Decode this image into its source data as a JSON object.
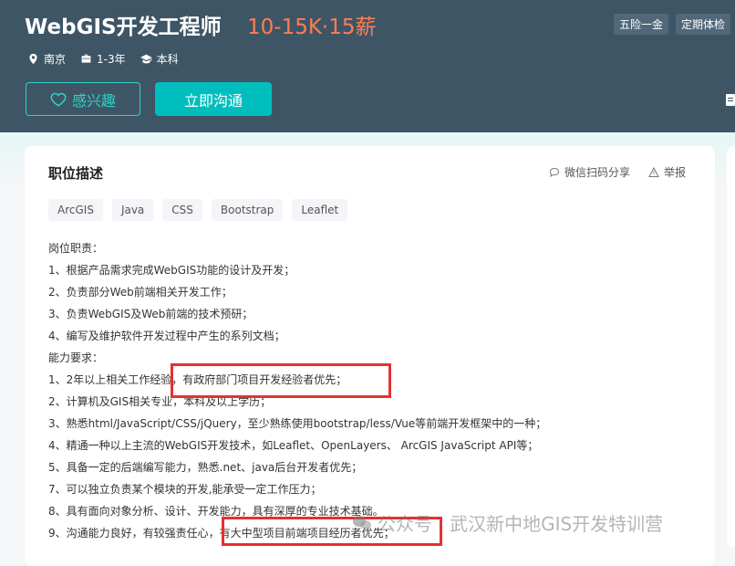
{
  "job": {
    "title": "WebGIS开发工程师",
    "salary": "10-15K·15薪",
    "benefits": [
      "五险一金",
      "定期体检"
    ],
    "meta": [
      {
        "icon": "location-icon",
        "text": "南京"
      },
      {
        "icon": "briefcase-icon",
        "text": "1-3年"
      },
      {
        "icon": "graduation-cap-icon",
        "text": "本科"
      }
    ]
  },
  "actions": {
    "interest_label": "感兴趣",
    "chat_label": "立即沟通"
  },
  "card": {
    "title": "职位描述",
    "share_label": "微信扫码分享",
    "report_label": "举报",
    "tags": [
      "ArcGIS",
      "Java",
      "CSS",
      "Bootstrap",
      "Leaflet"
    ],
    "description": [
      "岗位职责：",
      "1、根据产品需求完成WebGIS功能的设计及开发；",
      "2、负责部分Web前端相关开发工作；",
      "3、负责WebGIS及Web前端的技术预研；",
      "4、编写及维护软件开发过程中产生的系列文档；",
      "能力要求：",
      "1、2年以上相关工作经验，有政府部门项目开发经验者优先；",
      "2、计算机及GIS相关专业，本科及以上学历；",
      "3、熟悉html/JavaScript/CSS/jQuery，至少熟练使用bootstrap/less/Vue等前端开发框架中的一种；",
      "4、精通一种以上主流的WebGIS开发技术，如Leaflet、OpenLayers、 ArcGIS JavaScript API等；",
      "5、具备一定的后端编写能力，熟悉.net、java后台开发者优先；",
      "7、可以独立负责某个模块的开发,能承受一定工作压力；",
      "8、具有面向对象分析、设计、开发能力，具有深厚的专业技术基础。",
      "9、沟通能力良好，有较强责任心，有大中型项目前端项目经历者优先；"
    ]
  },
  "watermark": "公众号 · 武汉新中地GIS开发特训营",
  "colors": {
    "header_bg": "#3e5566",
    "accent": "#00bebd",
    "salary": "#ff7d52",
    "highlight": "#e8302f"
  }
}
